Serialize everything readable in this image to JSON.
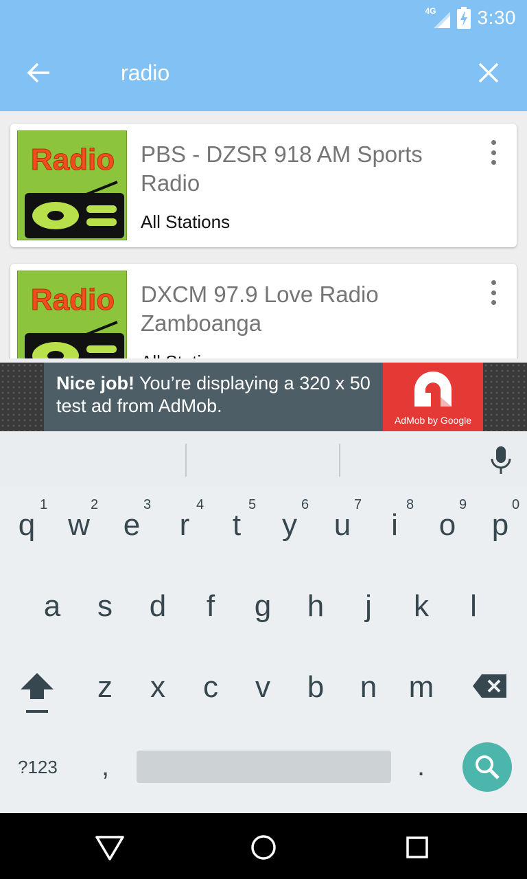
{
  "status_bar": {
    "network": "4G",
    "time": "3:30"
  },
  "search": {
    "query": "radio"
  },
  "results": [
    {
      "title": "PBS - DZSR 918 AM Sports Radio",
      "category": "All Stations",
      "logo_text": "Radio"
    },
    {
      "title": "DXCM 97.9 Love Radio Zamboanga",
      "category": "All Stations",
      "logo_text": "Radio"
    }
  ],
  "ad": {
    "headline": "Nice job!",
    "message": " You’re displaying a 320 x 50 test ad from AdMob.",
    "brand": "AdMob by Google"
  },
  "keyboard": {
    "row1": [
      "q",
      "w",
      "e",
      "r",
      "t",
      "y",
      "u",
      "i",
      "o",
      "p"
    ],
    "row1_hints": [
      "1",
      "2",
      "3",
      "4",
      "5",
      "6",
      "7",
      "8",
      "9",
      "0"
    ],
    "row2": [
      "a",
      "s",
      "d",
      "f",
      "g",
      "h",
      "j",
      "k",
      "l"
    ],
    "row3": [
      "z",
      "x",
      "c",
      "v",
      "b",
      "n",
      "m"
    ],
    "symbols_label": "?123",
    "comma": ",",
    "period": "."
  },
  "colors": {
    "app_bar": "#82c1f3",
    "search_key": "#4db6ac",
    "ad_red": "#e53935"
  }
}
